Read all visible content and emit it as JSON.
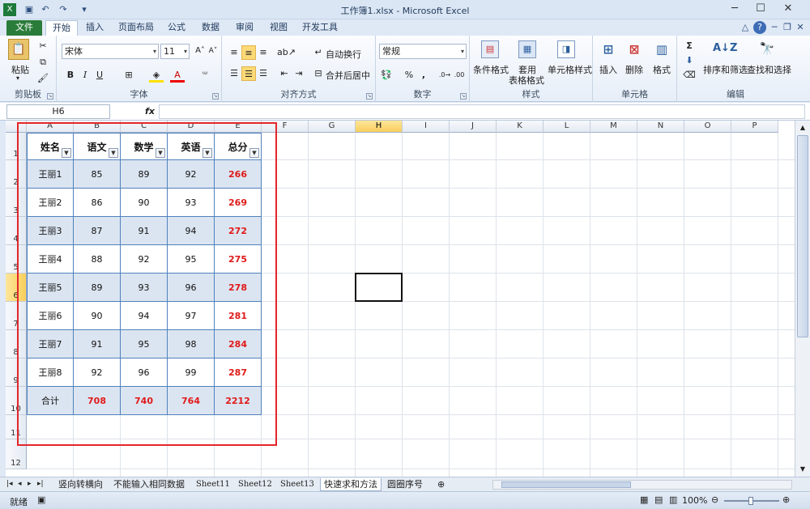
{
  "window": {
    "title": "工作簿1.xlsx - Microsoft Excel"
  },
  "tabs": [
    "文件",
    "开始",
    "插入",
    "页面布局",
    "公式",
    "数据",
    "审阅",
    "视图",
    "开发工具"
  ],
  "ribbon": {
    "clipboard": {
      "label": "剪贴板",
      "paste": "粘贴"
    },
    "font": {
      "label": "字体",
      "name": "宋体",
      "size": "11",
      "bold": "B",
      "italic": "I",
      "underline": "U"
    },
    "alignment": {
      "label": "对齐方式",
      "wrap": "自动换行",
      "merge": "合并后居中"
    },
    "number": {
      "label": "数字",
      "format": "常规",
      "percent": "%",
      "comma": ","
    },
    "styles": {
      "label": "样式",
      "conditional": "条件格式",
      "table1": "套用",
      "table2": "表格格式",
      "cell": "单元格样式"
    },
    "cells": {
      "label": "单元格",
      "insert": "插入",
      "delete": "删除",
      "format": "格式"
    },
    "editing": {
      "label": "编辑",
      "sort": "排序和筛选",
      "find": "查找和选择",
      "sum": "Σ"
    }
  },
  "formula_bar": {
    "name_box": "H6",
    "fx": "fx",
    "value": ""
  },
  "columns": [
    "A",
    "B",
    "C",
    "D",
    "E",
    "F",
    "G",
    "H",
    "I",
    "J",
    "K",
    "L",
    "M",
    "N",
    "O",
    "P"
  ],
  "selected_column": "H",
  "rows": [
    "1",
    "2",
    "3",
    "4",
    "5",
    "6",
    "7",
    "8",
    "9",
    "10",
    "11",
    "12"
  ],
  "selected_row": "6",
  "table": {
    "headers": [
      "姓名",
      "语文",
      "数学",
      "英语",
      "总分"
    ],
    "rows": [
      [
        "王丽1",
        "85",
        "89",
        "92",
        "266"
      ],
      [
        "王丽2",
        "86",
        "90",
        "93",
        "269"
      ],
      [
        "王丽3",
        "87",
        "91",
        "94",
        "272"
      ],
      [
        "王丽4",
        "88",
        "92",
        "95",
        "275"
      ],
      [
        "王丽5",
        "89",
        "93",
        "96",
        "278"
      ],
      [
        "王丽6",
        "90",
        "94",
        "97",
        "281"
      ],
      [
        "王丽7",
        "91",
        "95",
        "98",
        "284"
      ],
      [
        "王丽8",
        "92",
        "96",
        "99",
        "287"
      ]
    ],
    "total": [
      "合计",
      "708",
      "740",
      "764",
      "2212"
    ]
  },
  "sheet_tabs": [
    "竖向转横向",
    "不能输入相同数据",
    "Sheet11",
    "Sheet12",
    "Sheet13",
    "快速求和方法",
    "圆圈序号"
  ],
  "status": {
    "ready": "就绪",
    "zoom": "100%"
  },
  "colors": {
    "accent_red": "#e4262a",
    "total_text": "#e01a1a",
    "file_tab": "#2a7c3a",
    "band": "#dbe5f1"
  }
}
